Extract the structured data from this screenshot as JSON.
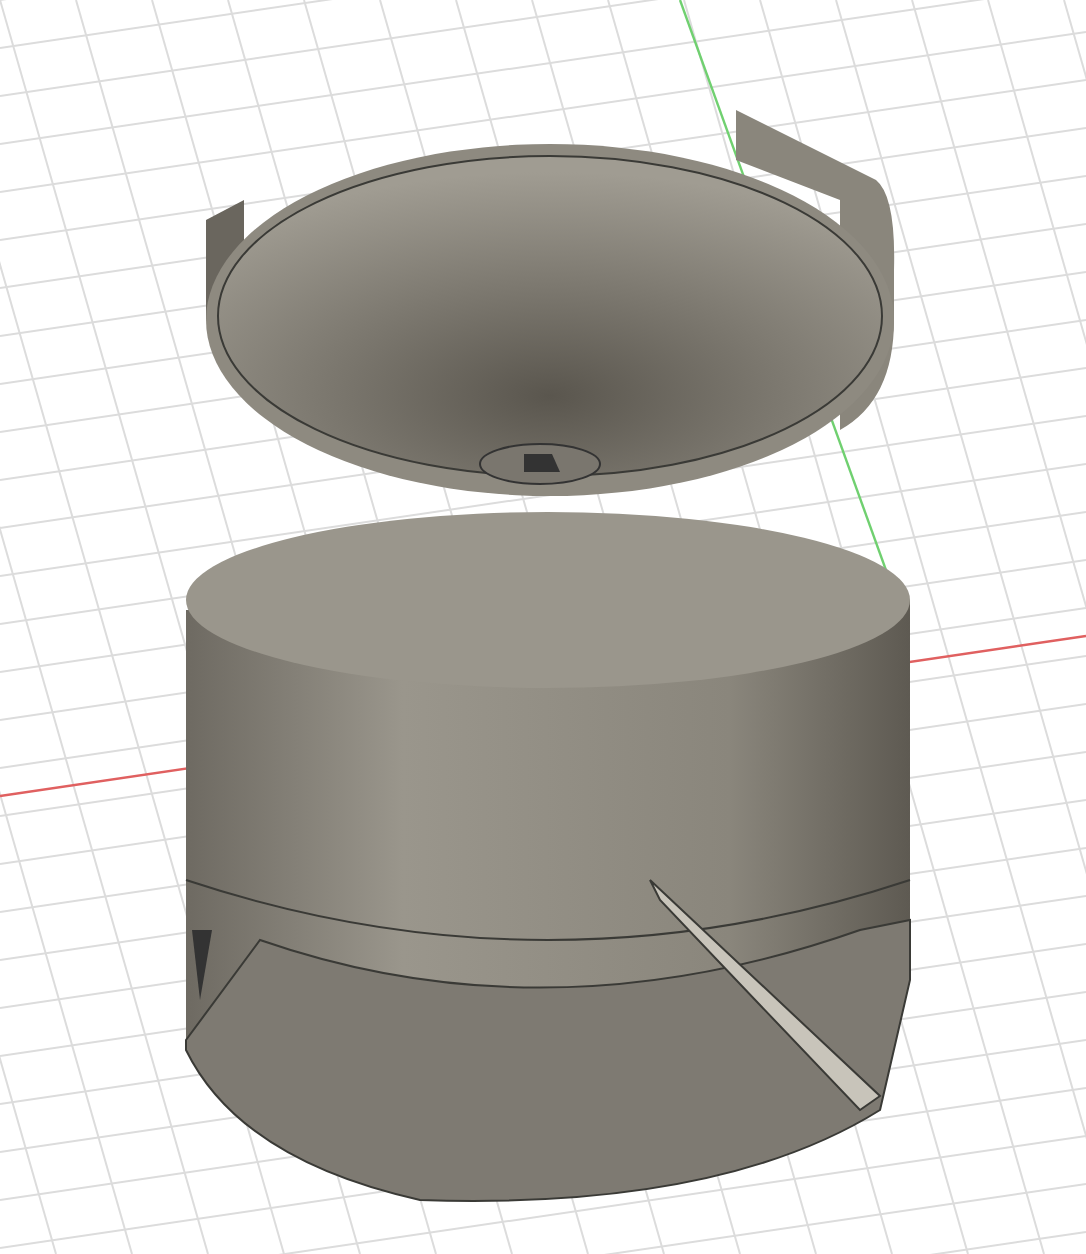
{
  "viewport": {
    "axes": [
      {
        "kind": "x",
        "color": "#e06060"
      },
      {
        "kind": "y",
        "color": "#70d070"
      }
    ]
  }
}
